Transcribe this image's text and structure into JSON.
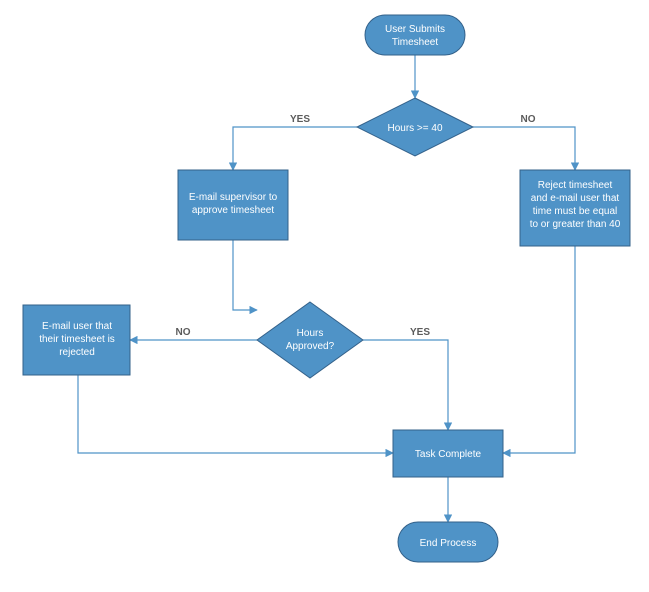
{
  "chart_data": {
    "type": "flowchart",
    "nodes": [
      {
        "id": "start",
        "shape": "terminator",
        "label_lines": [
          "User Submits",
          "Timesheet"
        ]
      },
      {
        "id": "dec_hours40",
        "shape": "decision",
        "label_lines": [
          "Hours >= 40"
        ]
      },
      {
        "id": "proc_email_sup",
        "shape": "process",
        "label_lines": [
          "E-mail supervisor to",
          "approve timesheet"
        ]
      },
      {
        "id": "proc_reject40",
        "shape": "process",
        "label_lines": [
          "Reject timesheet",
          "and e-mail user that",
          "time must be equal",
          "to or greater than 40"
        ]
      },
      {
        "id": "dec_approved",
        "shape": "decision",
        "label_lines": [
          "Hours",
          "Approved?"
        ]
      },
      {
        "id": "proc_email_rej",
        "shape": "process",
        "label_lines": [
          "E-mail user that",
          "their timesheet is",
          "rejected"
        ]
      },
      {
        "id": "proc_complete",
        "shape": "process",
        "label_lines": [
          "Task Complete"
        ]
      },
      {
        "id": "end",
        "shape": "terminator",
        "label_lines": [
          "End Process"
        ]
      }
    ],
    "edges": [
      {
        "from": "start",
        "to": "dec_hours40",
        "label": ""
      },
      {
        "from": "dec_hours40",
        "to": "proc_email_sup",
        "label": "YES"
      },
      {
        "from": "dec_hours40",
        "to": "proc_reject40",
        "label": "NO"
      },
      {
        "from": "proc_email_sup",
        "to": "dec_approved",
        "label": ""
      },
      {
        "from": "dec_approved",
        "to": "proc_email_rej",
        "label": "NO"
      },
      {
        "from": "dec_approved",
        "to": "proc_complete",
        "label": "YES"
      },
      {
        "from": "proc_email_rej",
        "to": "proc_complete",
        "label": ""
      },
      {
        "from": "proc_reject40",
        "to": "proc_complete",
        "label": ""
      },
      {
        "from": "proc_complete",
        "to": "end",
        "label": ""
      }
    ],
    "labels": {
      "yes": "YES",
      "no": "NO"
    },
    "colors": {
      "node_fill": "#4f93c7",
      "node_stroke": "#33618a",
      "connector": "#4f93c7",
      "text": "#ffffff",
      "edge_label": "#5b5b5b"
    }
  }
}
